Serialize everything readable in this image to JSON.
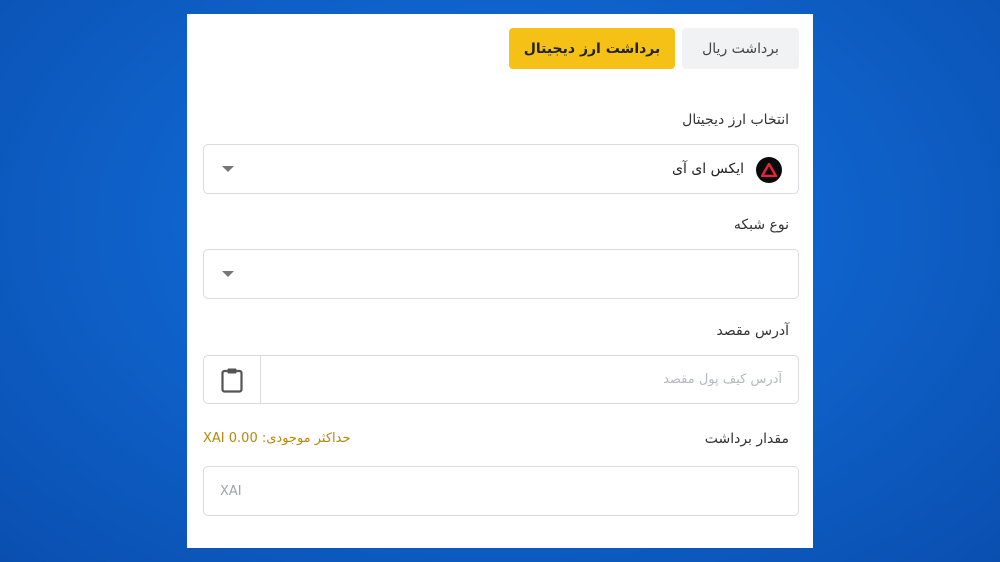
{
  "tabs": {
    "rial_label": "برداشت ریال",
    "crypto_label": "برداشت ارز دیجیتال"
  },
  "currency": {
    "label": "انتخاب ارز دیجیتال",
    "selected": "ایکس ای آی",
    "icon": "xai-coin-icon"
  },
  "network": {
    "label": "نوع شبکه",
    "selected": ""
  },
  "address": {
    "label": "آدرس مقصد",
    "placeholder": "آدرس کیف پول مقصد",
    "icon": "clipboard-icon"
  },
  "amount": {
    "label": "مقدار برداشت",
    "max_text": "حداکثر موجودی: XAI 0.00",
    "placeholder": "XAI"
  },
  "colors": {
    "accent": "#f5c117",
    "max_text": "#b8860b",
    "background": "#0f63cc"
  }
}
